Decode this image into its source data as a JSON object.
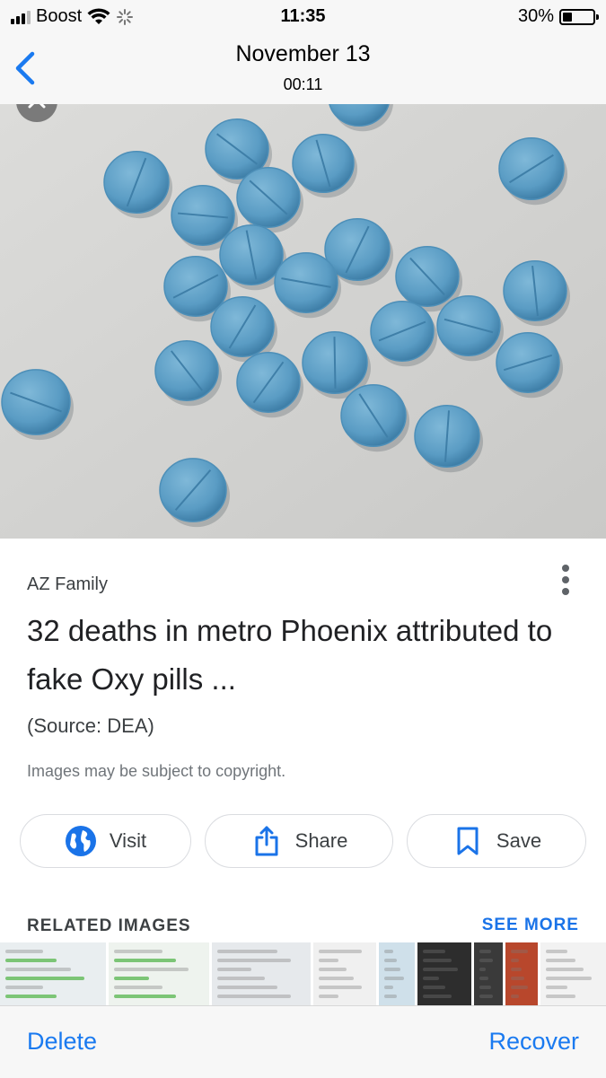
{
  "status_bar": {
    "carrier": "Boost",
    "time": "11:35",
    "battery_percent": "30%",
    "battery_level": 0.3
  },
  "nav": {
    "title": "November 13",
    "subtitle": "00:11"
  },
  "result": {
    "source": "AZ Family",
    "headline": "32 deaths in metro Phoenix attributed to fake Oxy pills ...",
    "caption": "(Source: DEA)",
    "copyright_notice": "Images may be subject to copyright."
  },
  "actions": {
    "visit": "Visit",
    "share": "Share",
    "save": "Save"
  },
  "related": {
    "title": "RELATED IMAGES",
    "see_more": "SEE MORE",
    "thumbnail_count": 11
  },
  "toolbar": {
    "delete": "Delete",
    "recover": "Recover"
  },
  "colors": {
    "accent_blue": "#1a73e8",
    "ios_blue": "#1a7af0",
    "pill_blue": "#5fa2c9",
    "bar_gray": "#f7f7f7"
  }
}
